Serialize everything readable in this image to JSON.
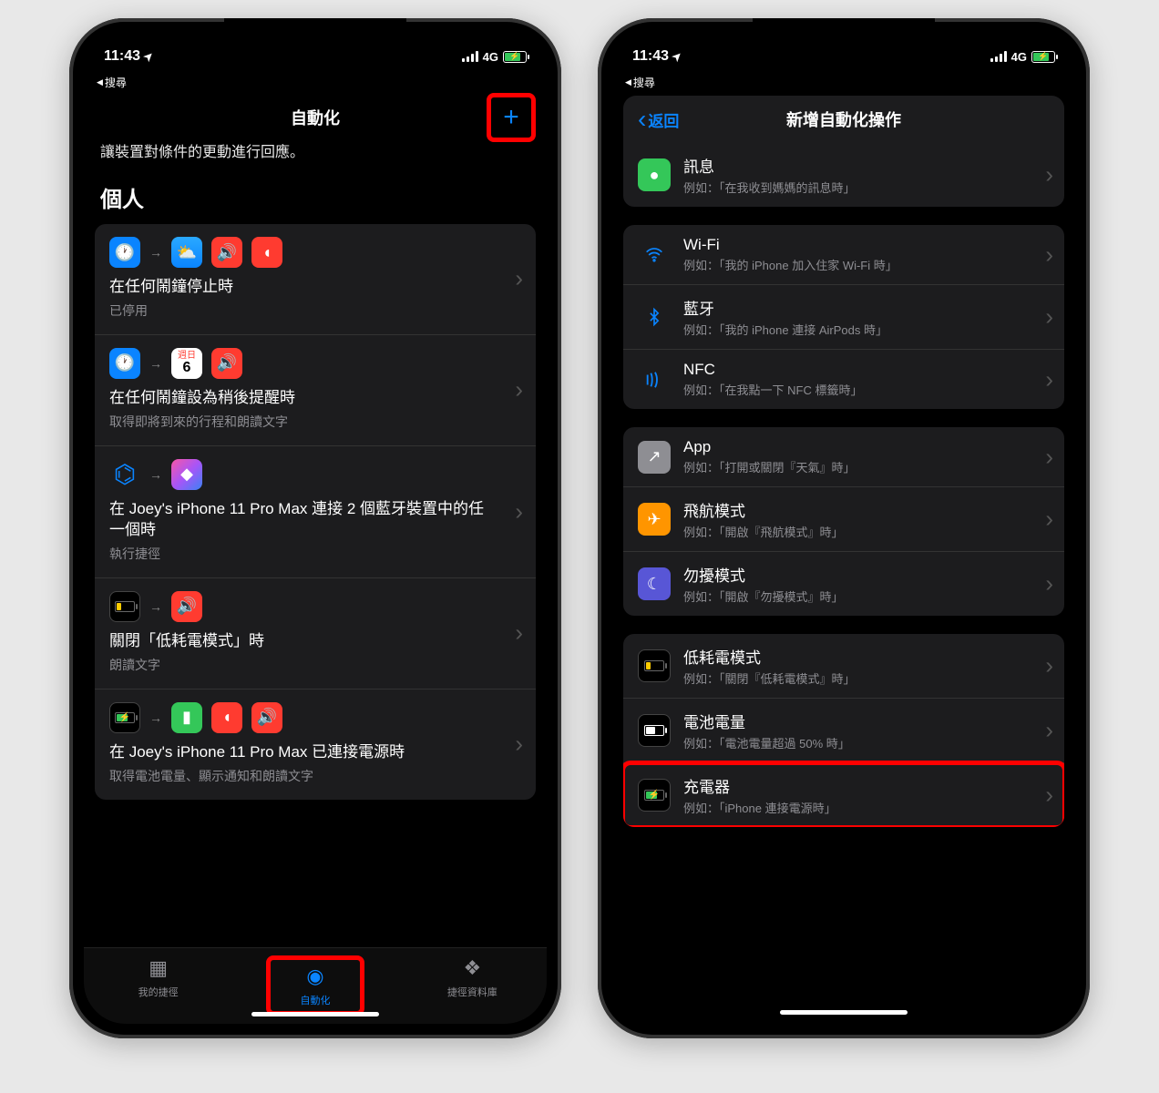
{
  "status": {
    "time": "11:43",
    "network": "4G",
    "back_search": "搜尋"
  },
  "left_screen": {
    "title": "自動化",
    "description": "讓裝置對條件的更動進行回應。",
    "section": "個人",
    "items": [
      {
        "title": "在任何鬧鐘停止時",
        "sub": "已停用"
      },
      {
        "title": "在任何鬧鐘設為稍後提醒時",
        "sub": "取得即將到來的行程和朗讀文字"
      },
      {
        "title": "在 Joey's iPhone 11 Pro Max 連接 2 個藍牙裝置中的任一個時",
        "sub": "執行捷徑"
      },
      {
        "title": "關閉「低耗電模式」時",
        "sub": "朗讀文字"
      },
      {
        "title": "在 Joey's iPhone 11 Pro Max 已連接電源時",
        "sub": "取得電池電量、顯示通知和朗讀文字"
      }
    ],
    "cal_day_label": "週日",
    "cal_day_num": "6",
    "tabs": [
      {
        "label": "我的捷徑"
      },
      {
        "label": "自動化"
      },
      {
        "label": "捷徑資料庫"
      }
    ]
  },
  "right_screen": {
    "back": "返回",
    "title": "新增自動化操作",
    "groups": [
      [
        {
          "key": "messages",
          "title": "訊息",
          "sub": "例如：「在我收到媽媽的訊息時」"
        }
      ],
      [
        {
          "key": "wifi",
          "title": "Wi-Fi",
          "sub": "例如：「我的 iPhone 加入住家 Wi-Fi 時」"
        },
        {
          "key": "bluetooth",
          "title": "藍牙",
          "sub": "例如：「我的 iPhone 連接 AirPods 時」"
        },
        {
          "key": "nfc",
          "title": "NFC",
          "sub": "例如：「在我點一下 NFC 標籤時」"
        }
      ],
      [
        {
          "key": "app",
          "title": "App",
          "sub": "例如：「打開或關閉『天氣』時」"
        },
        {
          "key": "airplane",
          "title": "飛航模式",
          "sub": "例如：「開啟『飛航模式』時」"
        },
        {
          "key": "dnd",
          "title": "勿擾模式",
          "sub": "例如：「開啟『勿擾模式』時」"
        }
      ],
      [
        {
          "key": "lowpower",
          "title": "低耗電模式",
          "sub": "例如：「關閉『低耗電模式』時」"
        },
        {
          "key": "battery",
          "title": "電池電量",
          "sub": "例如：「電池電量超過 50% 時」"
        },
        {
          "key": "charger",
          "title": "充電器",
          "sub": "例如：「iPhone 連接電源時」"
        }
      ]
    ]
  }
}
